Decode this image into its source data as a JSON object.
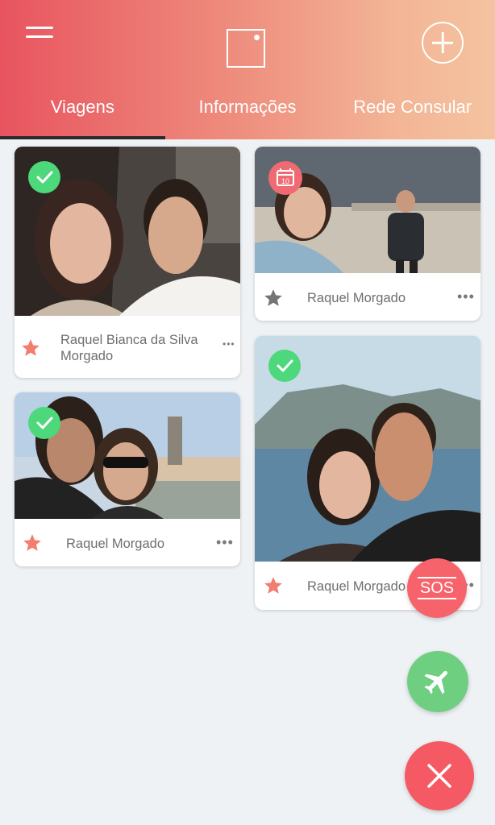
{
  "header": {
    "tabs": [
      {
        "label": "Viagens",
        "active": true
      },
      {
        "label": "Informações",
        "active": false
      },
      {
        "label": "Rede Consular",
        "active": false
      }
    ],
    "icons": [
      "menu-icon",
      "logo-icon",
      "add-icon"
    ]
  },
  "trips": [
    {
      "name": "Raquel Bianca da Silva Morgado",
      "status": "check-icon",
      "favorite": true,
      "star_color": "#f27e6f"
    },
    {
      "name": "Raquel Morgado",
      "status": "check-icon",
      "favorite": true,
      "star_color": "#f27e6f"
    },
    {
      "name": "Raquel Morgado",
      "status": "calendar-icon",
      "calendar_day": "10",
      "favorite": false,
      "star_color": "#757575"
    },
    {
      "name": "Raquel Morgado",
      "status": "check-icon",
      "favorite": true,
      "star_color": "#f27e6f"
    }
  ],
  "more_label": "•••",
  "fabs": {
    "sos_label": "SOS",
    "plane_icon": "airplane-icon",
    "close_icon": "close-icon"
  },
  "colors": {
    "header_gradient_start": "#e8545f",
    "header_gradient_end": "#f4c3a0",
    "check_green": "#4cd87b",
    "sos_red": "#f7636b",
    "plane_green": "#6fcf80",
    "close_red": "#f55a64"
  }
}
